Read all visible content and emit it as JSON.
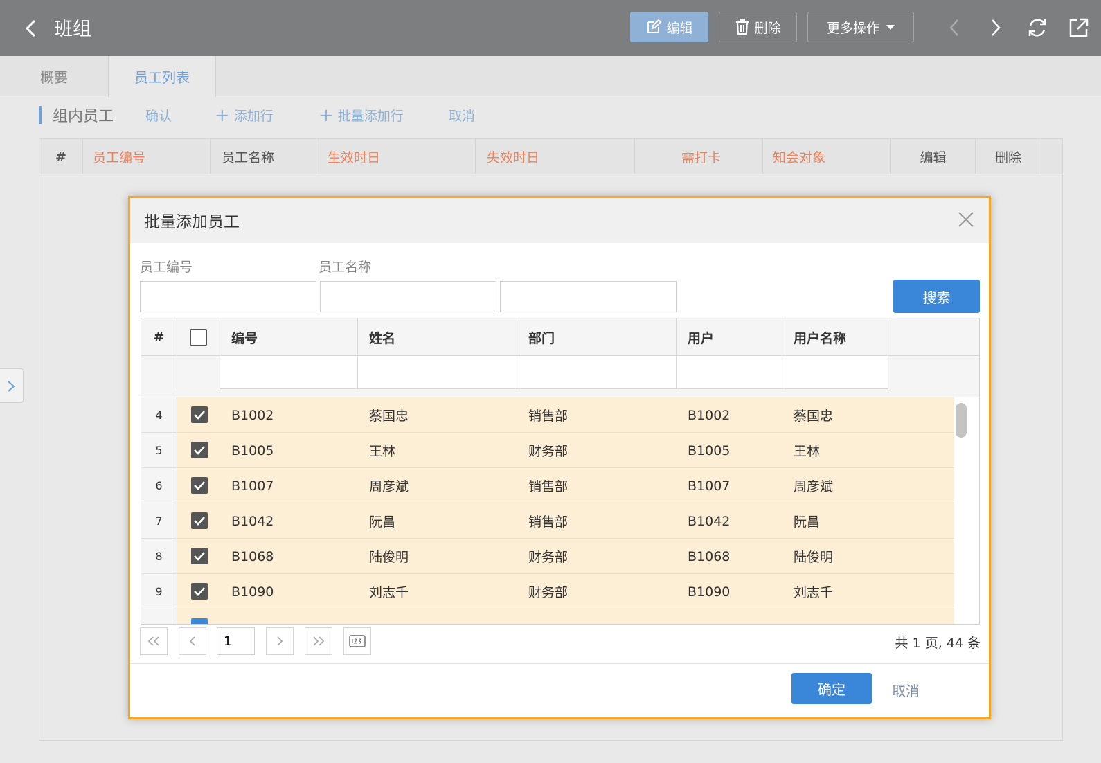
{
  "header": {
    "title": "班组",
    "edit_label": "编辑",
    "delete_label": "删除",
    "more_label": "更多操作"
  },
  "tabs": [
    {
      "label": "概要"
    },
    {
      "label": "员工列表"
    }
  ],
  "toolbar": {
    "section_title": "组内员工",
    "confirm_label": "确认",
    "add_row_label": "添加行",
    "batch_add_label": "批量添加行",
    "cancel_label": "取消"
  },
  "bg_table": {
    "columns": [
      "#",
      "员工编号",
      "员工名称",
      "生效时日",
      "失效时日",
      "需打卡",
      "知会对象",
      "编辑",
      "删除"
    ]
  },
  "modal": {
    "title": "批量添加员工",
    "filter_labels": [
      "员工编号",
      "员工名称"
    ],
    "search_label": "搜索",
    "columns": [
      "#",
      "",
      "编号",
      "姓名",
      "部门",
      "用户",
      "用户名称"
    ],
    "rows": [
      {
        "num": "4",
        "code": "B1002",
        "name": "蔡国忠",
        "dept": "销售部",
        "user": "B1002",
        "username": "蔡国忠"
      },
      {
        "num": "5",
        "code": "B1005",
        "name": "王林",
        "dept": "财务部",
        "user": "B1005",
        "username": "王林"
      },
      {
        "num": "6",
        "code": "B1007",
        "name": "周彦斌",
        "dept": "销售部",
        "user": "B1007",
        "username": "周彦斌"
      },
      {
        "num": "7",
        "code": "B1042",
        "name": "阮昌",
        "dept": "销售部",
        "user": "B1042",
        "username": "阮昌"
      },
      {
        "num": "8",
        "code": "B1068",
        "name": "陆俊明",
        "dept": "财务部",
        "user": "B1068",
        "username": "陆俊明"
      },
      {
        "num": "9",
        "code": "B1090",
        "name": "刘志千",
        "dept": "财务部",
        "user": "B1090",
        "username": "刘志千"
      }
    ],
    "pager": {
      "page_value": "1",
      "total_label": "共 1 页, 44 条"
    },
    "ok_label": "确定",
    "cancel_label": "取消"
  },
  "colors": {
    "header_bg": "#7d7e80",
    "accent_blue": "#3a86d9",
    "modal_border": "#f6a623",
    "selected_row": "#fdeed6",
    "required_red": "#e8835e"
  }
}
